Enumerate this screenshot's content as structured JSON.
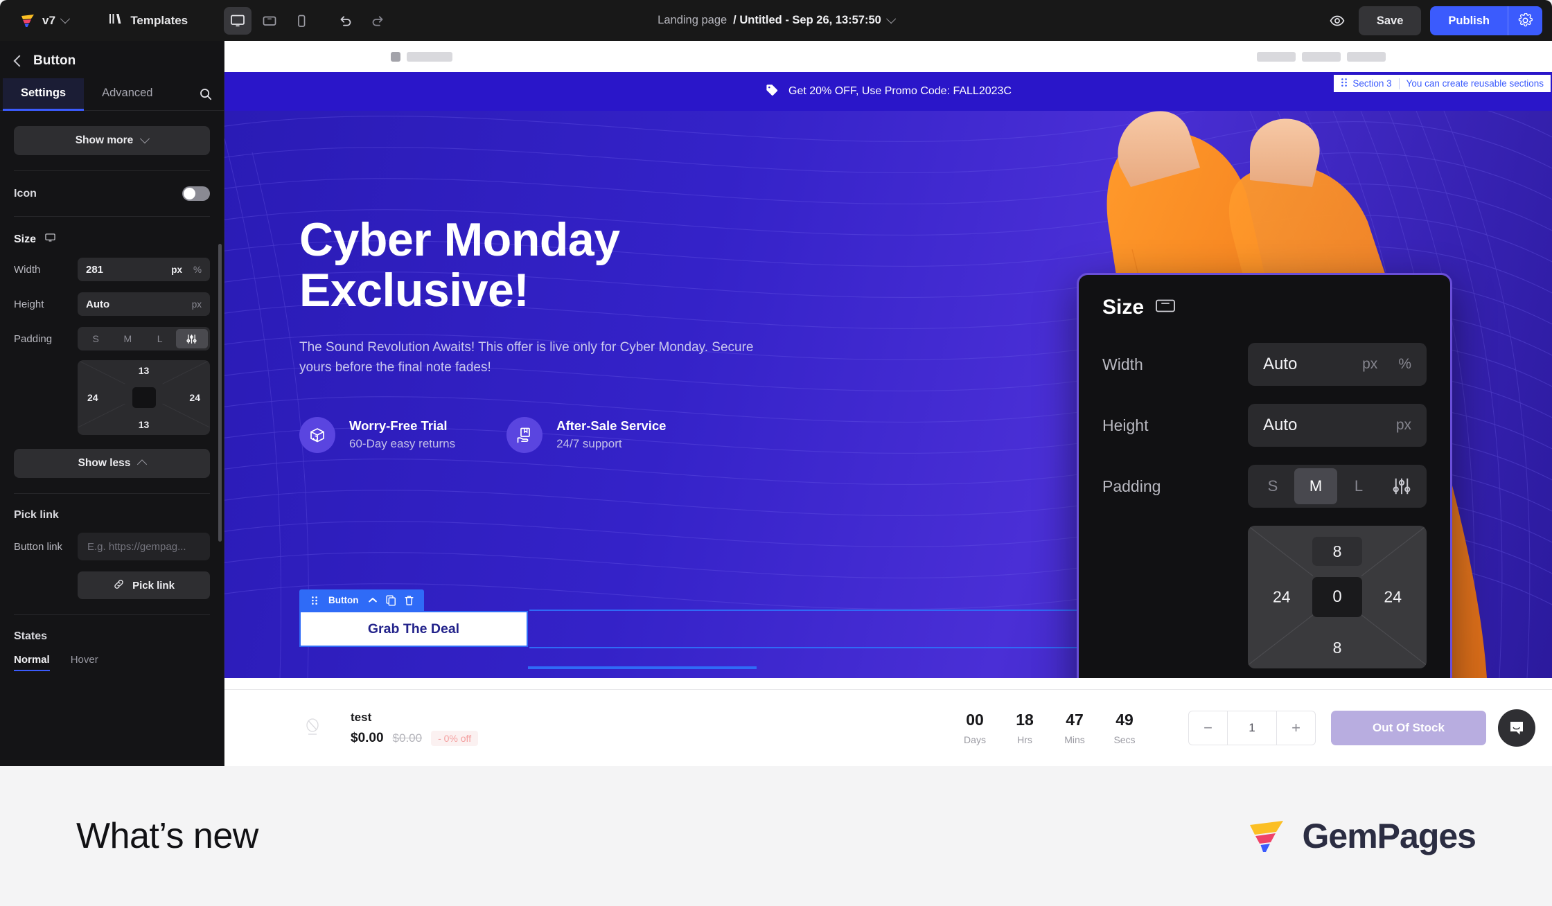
{
  "topbar": {
    "version_label": "v7",
    "templates_label": "Templates",
    "devices": [
      {
        "name": "desktop",
        "icon": "desktop-icon",
        "active": true
      },
      {
        "name": "tablet",
        "icon": "tablet-icon",
        "active": false
      },
      {
        "name": "mobile",
        "icon": "mobile-icon",
        "active": false
      }
    ],
    "undo_icon": "undo-icon",
    "redo_icon": "redo-icon",
    "page_type": "Landing page",
    "page_name": "/ Untitled - Sep 26, 13:57:50",
    "preview_icon": "eye-icon",
    "save_label": "Save",
    "publish_label": "Publish",
    "publish_gear_icon": "gear-icon",
    "accent": "#3b5bfd"
  },
  "left_panel": {
    "title": "Button",
    "back_icon": "chevron-left-icon",
    "tabs": [
      {
        "label": "Settings",
        "active": true
      },
      {
        "label": "Advanced",
        "active": false
      }
    ],
    "search_icon": "search-icon",
    "show_more": "Show more",
    "icon_row_label": "Icon",
    "icon_toggle_on": false,
    "size": {
      "heading": "Size",
      "device_icon": "desktop-icon",
      "width_label": "Width",
      "width_value": "281",
      "width_units": [
        {
          "label": "px",
          "active": true
        },
        {
          "label": "%",
          "active": false
        }
      ],
      "height_label": "Height",
      "height_value": "Auto",
      "height_units": [
        {
          "label": "px",
          "active": false
        }
      ],
      "padding_label": "Padding",
      "padding_presets": [
        {
          "label": "S",
          "active": false
        },
        {
          "label": "M",
          "active": false
        },
        {
          "label": "L",
          "active": false
        },
        {
          "label": "sliders-icon",
          "active": true
        }
      ],
      "padding_box": {
        "top": "13",
        "right": "24",
        "bottom": "13",
        "left": "24",
        "center": ""
      }
    },
    "show_less": "Show less",
    "pick_link": {
      "heading": "Pick link",
      "field_label": "Button link",
      "placeholder": "E.g. https://gempag...",
      "button_label": "Pick link",
      "button_icon": "link-icon"
    },
    "states": {
      "heading": "States",
      "items": [
        {
          "label": "Normal",
          "active": true
        },
        {
          "label": "Hover",
          "active": false
        }
      ]
    }
  },
  "canvas": {
    "section_tag": {
      "drag_icon": "drag-dots-icon",
      "name": "Section 3",
      "hint": "You can create reusable sections"
    },
    "promo": {
      "icon": "tag-icon",
      "text": "Get 20% OFF, Use Promo Code: FALL2023C",
      "bg": "#2a16c9"
    },
    "hero": {
      "headline_line1": "Cyber Monday",
      "headline_line2": "Exclusive!",
      "subtext": "The Sound Revolution Awaits! This offer is live only for Cyber Monday. Secure yours before the final note fades!",
      "features": [
        {
          "icon": "box-return-icon",
          "title": "Worry-Free Trial",
          "sub": "60-Day easy returns"
        },
        {
          "icon": "hand-book-icon",
          "title": "After-Sale Service",
          "sub": "24/7 support"
        }
      ],
      "button": {
        "toolbar_drag_icon": "drag-dots-icon",
        "toolbar_label": "Button",
        "toolbar_chevron_icon": "chevron-up-icon",
        "toolbar_copy_icon": "copy-icon",
        "toolbar_delete_icon": "trash-icon",
        "label": "Grab The Deal"
      }
    },
    "size_overlay": {
      "heading": "Size",
      "device_icon": "tablet-icon",
      "width_label": "Width",
      "width_value": "Auto",
      "width_units": [
        {
          "label": "px",
          "active": false
        },
        {
          "label": "%",
          "active": false
        }
      ],
      "height_label": "Height",
      "height_value": "Auto",
      "height_units": [
        {
          "label": "px",
          "active": false
        }
      ],
      "padding_label": "Padding",
      "padding_presets": [
        {
          "label": "S",
          "active": false
        },
        {
          "label": "M",
          "active": true
        },
        {
          "label": "L",
          "active": false
        },
        {
          "label": "sliders-icon",
          "active": false
        }
      ],
      "padding_box": {
        "top": "8",
        "right": "24",
        "bottom": "8",
        "left": "24",
        "center": "0"
      },
      "border_color": "#6a4fd8"
    },
    "product_bar": {
      "thumb_icon": "no-image-icon",
      "name": "test",
      "price": "$0.00",
      "compare_price": "$0.00",
      "discount": "- 0% off",
      "countdown": [
        {
          "value": "00",
          "label": "Days"
        },
        {
          "value": "18",
          "label": "Hrs"
        },
        {
          "value": "47",
          "label": "Mins"
        },
        {
          "value": "49",
          "label": "Secs"
        }
      ],
      "qty_minus": "−",
      "qty_value": "1",
      "qty_plus": "+",
      "cta_label": "Out Of Stock"
    },
    "chat_icon": "chat-bubble-icon"
  },
  "footer": {
    "whats_new": "What’s new",
    "logo_text": "GemPages",
    "logo_icon": "gempages-mark"
  }
}
